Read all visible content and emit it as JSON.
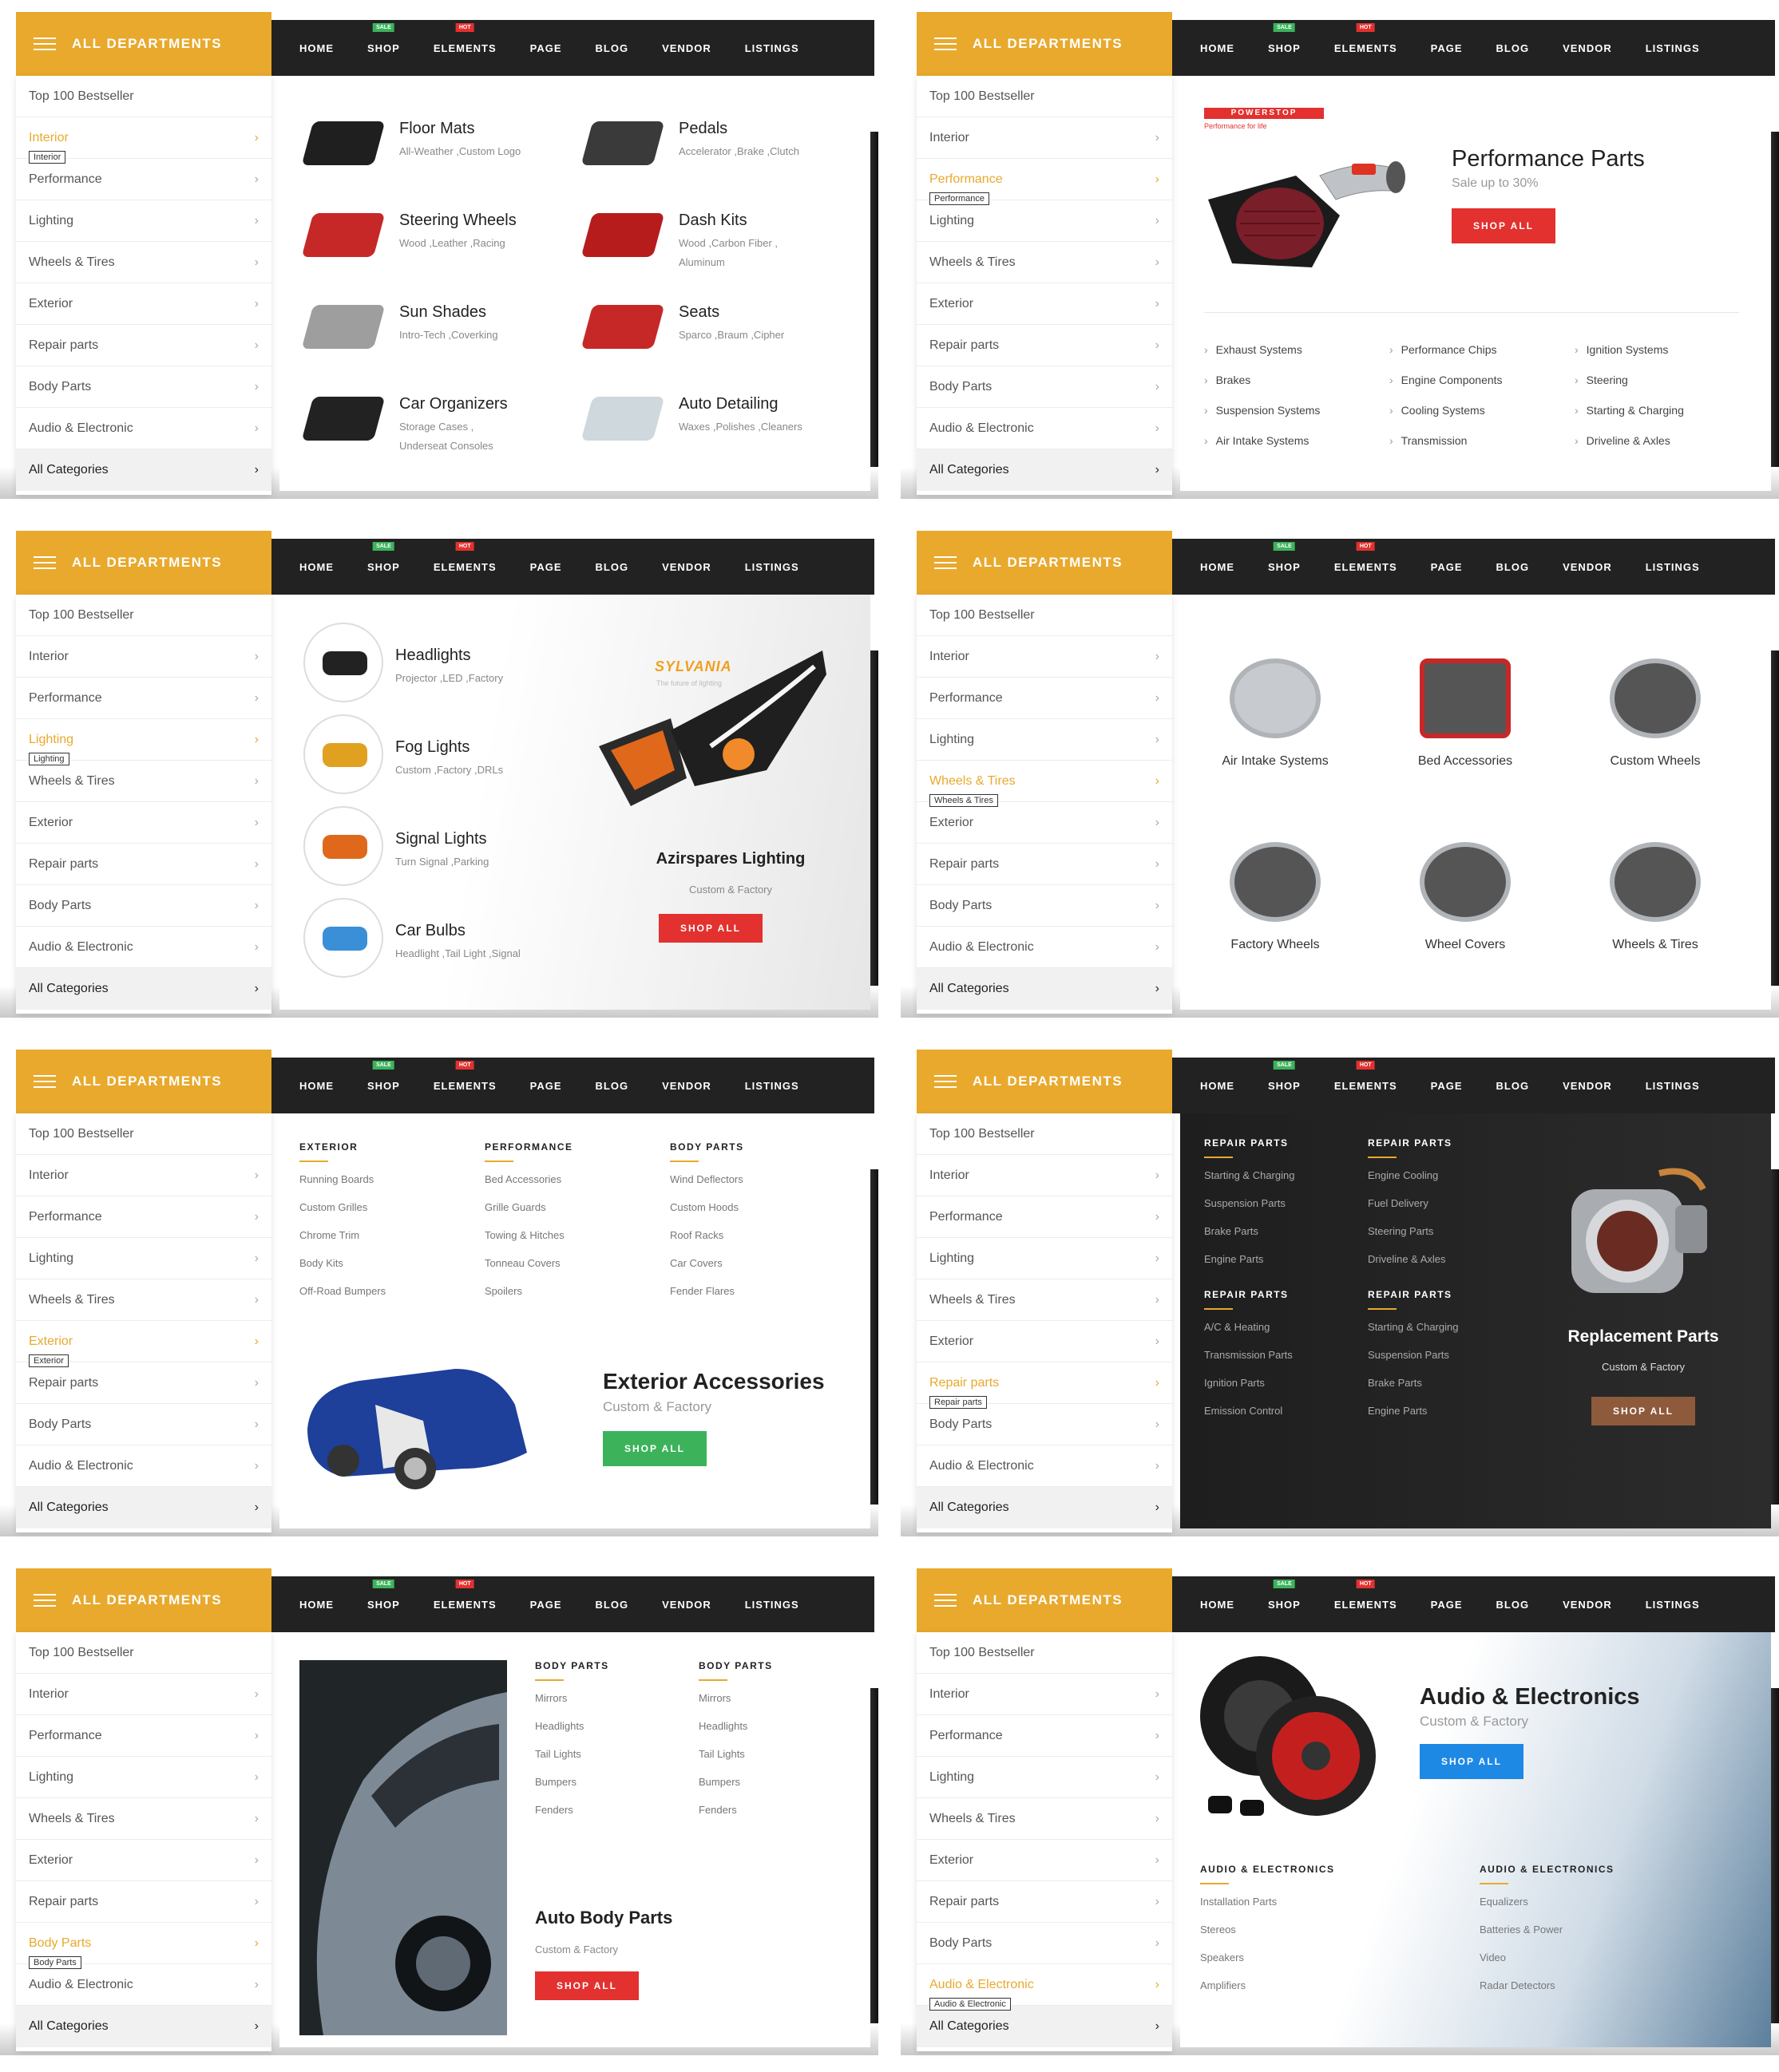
{
  "header": {
    "departments_label": "ALL DEPARTMENTS",
    "nav": [
      "HOME",
      "SHOP",
      "ELEMENTS",
      "PAGE",
      "BLOG",
      "VENDOR",
      "LISTINGS"
    ],
    "badge_sale": "SALE",
    "badge_hot": "HOT"
  },
  "sidebar": {
    "items": [
      "Top 100 Bestseller",
      "Interior",
      "Performance",
      "Lighting",
      "Wheels & Tires",
      "Exterior",
      "Repair parts",
      "Body Parts",
      "Audio & Electronic",
      "All Categories"
    ]
  },
  "colors": {
    "accent": "#e8a92d",
    "red": "#e2312f",
    "green": "#3cb35b",
    "blue": "#1e88e5",
    "brown": "#8d5a3b",
    "dark": "#222222"
  },
  "panels": {
    "interior": {
      "tooltip": "Interior",
      "items": [
        {
          "title": "Floor Mats",
          "sub": "All-Weather ,Custom Logo"
        },
        {
          "title": "Pedals",
          "sub": "Accelerator ,Brake ,Clutch"
        },
        {
          "title": "Steering Wheels",
          "sub": "Wood ,Leather ,Racing"
        },
        {
          "title": "Dash Kits",
          "sub": "Wood ,Carbon Fiber ,",
          "sub2": "Aluminum"
        },
        {
          "title": "Sun Shades",
          "sub": "Intro-Tech ,Coverking"
        },
        {
          "title": "Seats",
          "sub": "Sparco ,Braum ,Cipher"
        },
        {
          "title": "Car Organizers",
          "sub": "Storage Cases ,",
          "sub2": "Underseat Consoles"
        },
        {
          "title": "Auto Detailing",
          "sub": "Waxes ,Polishes ,Cleaners"
        }
      ]
    },
    "performance": {
      "tooltip": "Performance",
      "brand": "POWERSTOP",
      "brand_sub": "Performance for life",
      "title": "Performance Parts",
      "sub": "Sale up to 30%",
      "button": "SHOP ALL",
      "links": [
        "Exhaust Systems",
        "Performance Chips",
        "Ignition Systems",
        "Brakes",
        "Engine Components",
        "Steering",
        "Suspension Systems",
        "Cooling Systems",
        "Starting & Charging",
        "Air Intake Systems",
        "Transmission",
        "Driveline & Axles"
      ]
    },
    "lighting": {
      "tooltip": "Lighting",
      "items": [
        {
          "title": "Headlights",
          "sub": "Projector ,LED ,Factory"
        },
        {
          "title": "Fog Lights",
          "sub": "Custom ,Factory ,DRLs"
        },
        {
          "title": "Signal Lights",
          "sub": "Turn Signal ,Parking"
        },
        {
          "title": "Car Bulbs",
          "sub": "Headlight ,Tail Light ,Signal"
        }
      ],
      "brand": "SYLVANIA",
      "brand_sub": "The future of lighting",
      "title": "Azirspares Lighting",
      "sub": "Custom & Factory",
      "button": "SHOP ALL"
    },
    "wheels": {
      "tooltip": "Wheels & Tires",
      "items": [
        "Air Intake Systems",
        "Bed Accessories",
        "Custom Wheels",
        "Factory Wheels",
        "Wheel Covers",
        "Wheels & Tires"
      ]
    },
    "exterior": {
      "tooltip": "Exterior",
      "columns": [
        {
          "head": "EXTERIOR",
          "links": [
            "Running Boards",
            "Custom Grilles",
            "Chrome Trim",
            "Body Kits",
            "Off-Road Bumpers"
          ]
        },
        {
          "head": "PERFORMANCE",
          "links": [
            "Bed Accessories",
            "Grille Guards",
            "Towing & Hitches",
            "Tonneau Covers",
            "Spoilers"
          ]
        },
        {
          "head": "BODY PARTS",
          "links": [
            "Wind Deflectors",
            "Custom Hoods",
            "Roof Racks",
            "Car Covers",
            "Fender Flares"
          ]
        }
      ],
      "title": "Exterior Accessories",
      "sub": "Custom & Factory",
      "button": "SHOP ALL"
    },
    "repair": {
      "tooltip": "Repair parts",
      "columns": [
        {
          "head": "REPAIR PARTS",
          "links": [
            "Starting & Charging",
            "Suspension Parts",
            "Brake Parts",
            "Engine Parts"
          ]
        },
        {
          "head": "REPAIR PARTS",
          "links": [
            "Engine Cooling",
            "Fuel Delivery",
            "Steering Parts",
            "Driveline & Axles"
          ]
        },
        {
          "head": "REPAIR PARTS",
          "links": [
            "A/C & Heating",
            "Transmission Parts",
            "Ignition Parts",
            "Emission Control"
          ]
        },
        {
          "head": "REPAIR PARTS",
          "links": [
            "Starting & Charging",
            "Suspension Parts",
            "Brake Parts",
            "Engine Parts"
          ]
        }
      ],
      "title": "Replacement Parts",
      "sub": "Custom & Factory",
      "button": "SHOP ALL"
    },
    "body": {
      "tooltip": "Body Parts",
      "columns": [
        {
          "head": "BODY PARTS",
          "links": [
            "Mirrors",
            "Headlights",
            "Tail Lights",
            "Bumpers",
            "Fenders"
          ]
        },
        {
          "head": "BODY PARTS",
          "links": [
            "Mirrors",
            "Headlights",
            "Tail Lights",
            "Bumpers",
            "Fenders"
          ]
        }
      ],
      "title": "Auto Body Parts",
      "sub": "Custom & Factory",
      "button": "SHOP ALL"
    },
    "audio": {
      "tooltip": "Audio & Electronic",
      "title": "Audio & Electronics",
      "sub": "Custom & Factory",
      "button": "SHOP ALL",
      "columns": [
        {
          "head": "AUDIO & ELECTRONICS",
          "links": [
            "Installation Parts",
            "Stereos",
            "Speakers",
            "Amplifiers"
          ]
        },
        {
          "head": "AUDIO & ELECTRONICS",
          "links": [
            "Equalizers",
            "Batteries & Power",
            "Video",
            "Radar Detectors"
          ]
        }
      ]
    }
  }
}
